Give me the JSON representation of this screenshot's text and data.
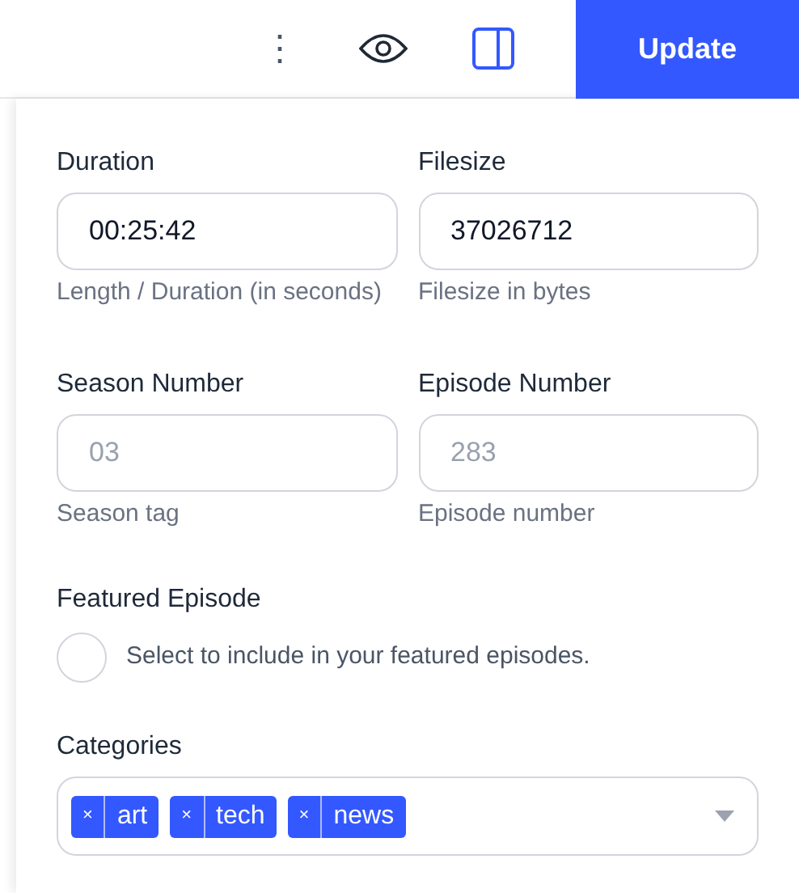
{
  "toolbar": {
    "more": "⋮",
    "update_button": "Update",
    "panel_toggle_selected": true
  },
  "fields": [
    {
      "label": "Duration",
      "value": "00:25:42",
      "hint": "Length / Duration (in seconds)"
    },
    {
      "label": "Filesize",
      "value": "37026712",
      "hint": "Filesize in bytes"
    },
    {
      "label": "Season Number",
      "placeholder": "03",
      "hint": "Season tag"
    },
    {
      "label": "Episode Number",
      "placeholder": "283",
      "hint": "Episode number"
    }
  ],
  "featured": {
    "label": "Featured Episode",
    "text": "Select to include in your featured episodes.",
    "checked": false
  },
  "categories": {
    "label": "Categories",
    "tags": [
      {
        "remove": "×",
        "label": "art"
      },
      {
        "remove": "×",
        "label": "tech"
      },
      {
        "remove": "×",
        "label": "news"
      }
    ]
  }
}
